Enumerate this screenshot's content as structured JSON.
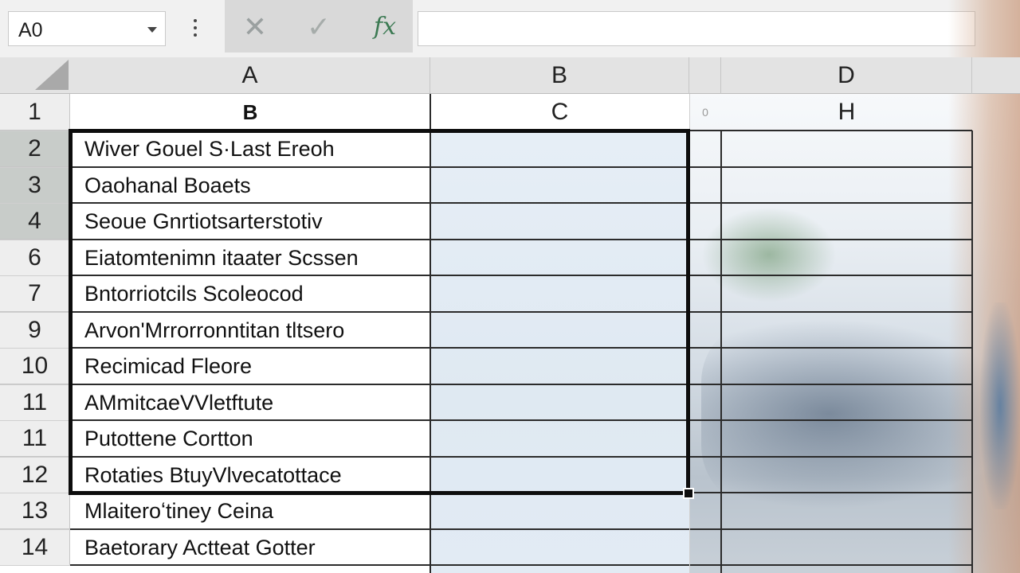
{
  "formula_bar": {
    "name_box": "A0",
    "fx_label": "fx",
    "cancel_glyph": "✕",
    "enter_glyph": "✓",
    "formula_value": ""
  },
  "columns": [
    "A",
    "B",
    "D"
  ],
  "header_row": {
    "row_number": "1",
    "a": "B",
    "b": "C",
    "narrow": "0",
    "d": "H"
  },
  "rows": [
    {
      "num": "2",
      "a": "Wiver Gouel S·Last Ereoh",
      "selected": true
    },
    {
      "num": "3",
      "a": "Oaohanal Boaets",
      "selected": true
    },
    {
      "num": "4",
      "a": "Seoue Gnrtiotsarterstotiv",
      "selected": true
    },
    {
      "num": "6",
      "a": "Eiatomtenimn itaater Scssen",
      "selected": false
    },
    {
      "num": "7",
      "a": "Bntorriotcils Scoleocod",
      "selected": false
    },
    {
      "num": "9",
      "a": "Arvon'Mrrorronntitan tltsero",
      "selected": false
    },
    {
      "num": "10",
      "a": "Recimicad Fleore",
      "selected": false
    },
    {
      "num": "11",
      "a": "AMmitcaeVVletftute",
      "selected": false
    },
    {
      "num": "11",
      "a": "Putottene Cortton",
      "selected": false
    },
    {
      "num": "12",
      "a": "Rotaties BtuyVlvecatottace",
      "selected": false
    },
    {
      "num": "13",
      "a": "Mlaiteroʻtiney Ceina",
      "selected": false
    },
    {
      "num": "14",
      "a": "Baetorary Actteat Gotter",
      "selected": false
    }
  ],
  "colors": {
    "selection_border": "#0d0d0d",
    "fx_color": "#3c7a53",
    "column_tint": "#e3ecf5"
  }
}
